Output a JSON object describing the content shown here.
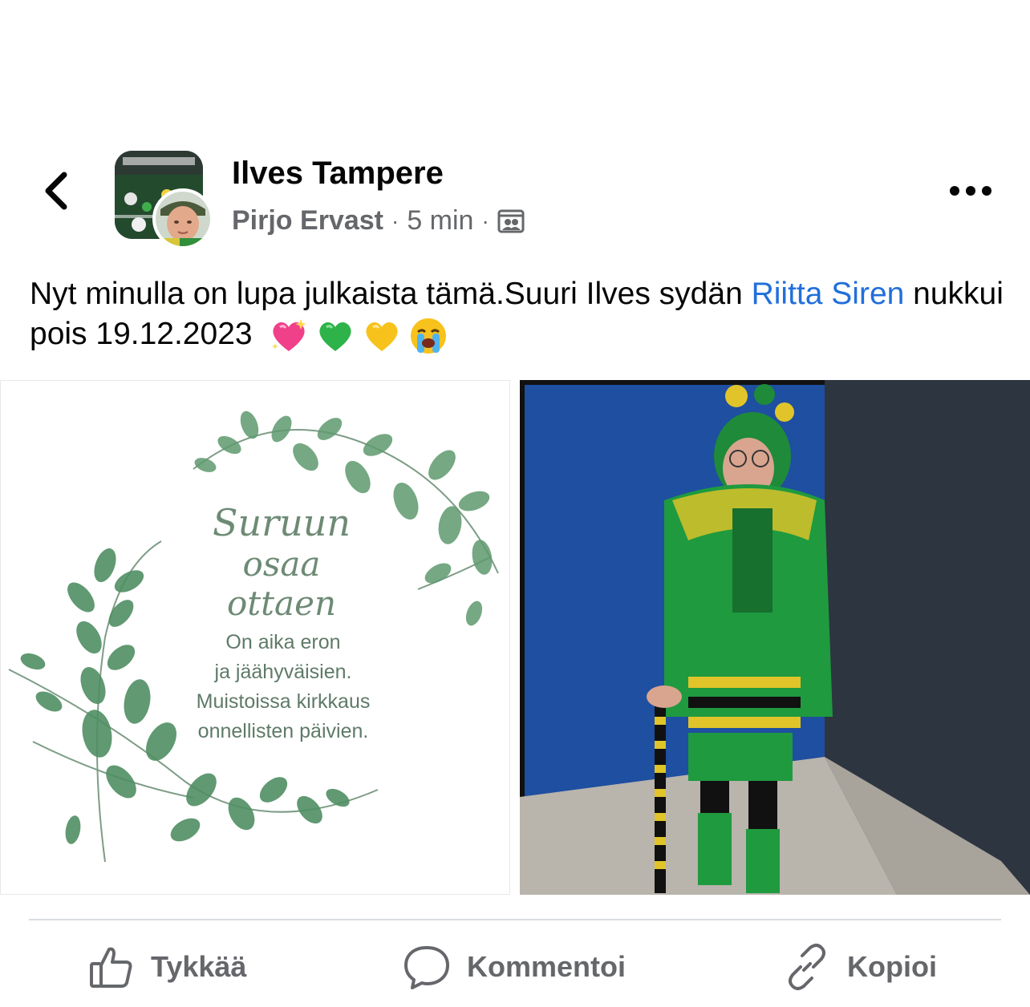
{
  "header": {
    "group_name": "Ilves Tampere",
    "author": "Pirjo Ervast",
    "time": "5 min",
    "separator": "·",
    "privacy_icon": "group-members-icon"
  },
  "post": {
    "text_before": "Nyt minulla on lupa julkaista tämä.Suuri Ilves sydän ",
    "mention": "Riitta Siren",
    "text_after": " nukkui pois 19.12.2023",
    "emojis": [
      "sparkling-heart",
      "green-heart",
      "yellow-heart",
      "loudly-crying-face"
    ]
  },
  "photos": {
    "left": {
      "title_line1": "Suruun",
      "title_line2": "osaa ottaen",
      "verse": [
        "On aika eron",
        "ja jäähyväisien.",
        "Muistoissa kirkkaus",
        "onnellisten päivien."
      ]
    },
    "right": {
      "subject": "person in green and yellow knitted fan outfit with cane"
    }
  },
  "actions": {
    "like": "Tykkää",
    "comment": "Kommentoi",
    "copy": "Kopioi"
  },
  "colors": {
    "mention": "#216fdb",
    "secondary_text": "#65676b",
    "divider": "#dadde1",
    "leaf_green": "#5e9a6e"
  }
}
